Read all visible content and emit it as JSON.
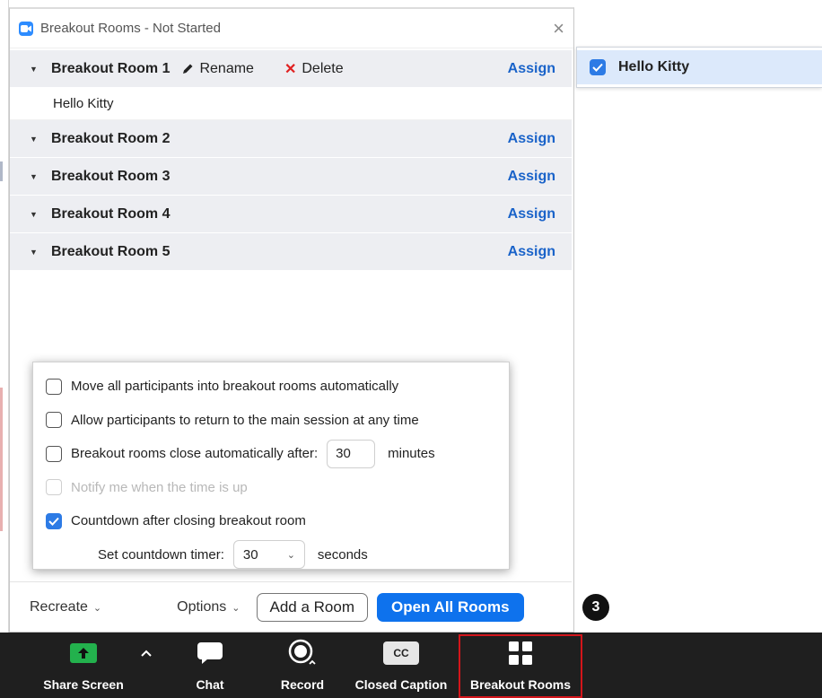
{
  "dialog": {
    "title": "Breakout Rooms - Not Started",
    "close_glyph": "×"
  },
  "rooms": [
    {
      "name": "Breakout Room 1",
      "assign": "Assign",
      "expanded": true,
      "rename": "Rename",
      "delete": "Delete",
      "participants": [
        "Hello Kitty"
      ]
    },
    {
      "name": "Breakout Room 2",
      "assign": "Assign"
    },
    {
      "name": "Breakout Room 3",
      "assign": "Assign"
    },
    {
      "name": "Breakout Room 4",
      "assign": "Assign"
    },
    {
      "name": "Breakout Room 5",
      "assign": "Assign"
    }
  ],
  "options": {
    "move_auto": {
      "label": "Move all participants into breakout rooms automatically",
      "checked": false
    },
    "allow_return": {
      "label": "Allow participants to return to the main session at any time",
      "checked": false
    },
    "auto_close": {
      "label": "Breakout rooms close automatically after:",
      "checked": false,
      "value": "30",
      "unit": "minutes"
    },
    "notify": {
      "label": "Notify me when the time is up",
      "checked": false,
      "disabled": true
    },
    "countdown": {
      "label": "Countdown after closing breakout room",
      "checked": true
    },
    "timer": {
      "label": "Set countdown timer:",
      "value": "30",
      "unit": "seconds"
    }
  },
  "footer": {
    "recreate": "Recreate",
    "options": "Options",
    "add_room": "Add a Room",
    "open_all": "Open All Rooms"
  },
  "step_badge": "3",
  "assign_panel": {
    "participant": "Hello Kitty",
    "checked": true
  },
  "toolbar": {
    "share_screen": "Share Screen",
    "chat": "Chat",
    "record": "Record",
    "closed_caption": "Closed Caption",
    "cc_icon_text": "CC",
    "breakout_rooms": "Breakout Rooms"
  },
  "colors": {
    "accent_blue": "#0e72ed",
    "assign_link": "#1a63c9",
    "highlight_red": "#d3151b",
    "share_green": "#23b14d",
    "toolbar_bg": "#1f1f1f"
  }
}
